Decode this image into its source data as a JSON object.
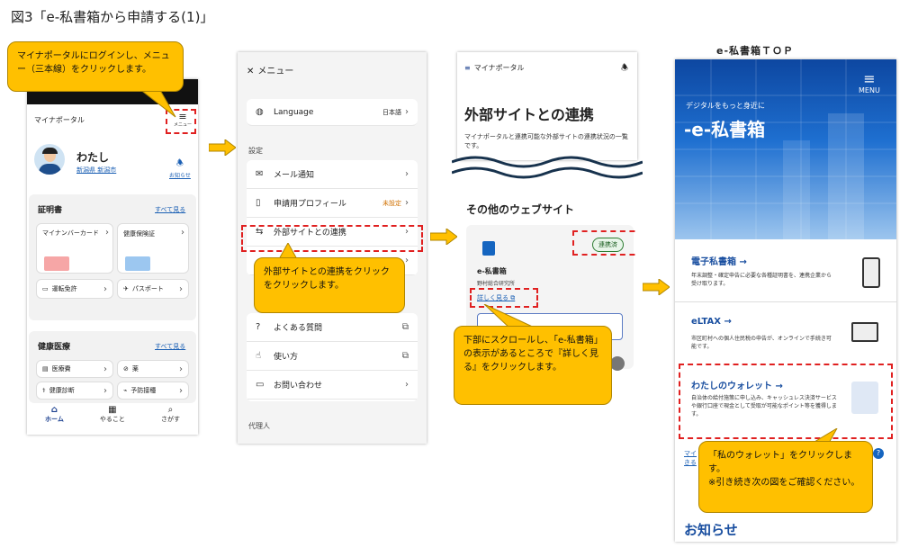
{
  "figure_title": "図3「e-私書箱から申請する(1)」",
  "screen1": {
    "app_name": "マイナポータル",
    "menu_label": "メニュー",
    "user_name": "わたし",
    "user_location": "新潟県 新潟市",
    "notice_label": "お知らせ",
    "cert_title": "証明書",
    "see_all": "すべて見る",
    "cert_items": [
      "マイナンバーカード",
      "健康保険証",
      "運転免許",
      "パスポート"
    ],
    "health_title": "健康医療",
    "health_see_all": "すべて見る",
    "health_items": [
      "医療費",
      "薬",
      "健康診断",
      "予防接種"
    ],
    "nav": [
      "ホーム",
      "やること",
      "さがす"
    ],
    "callout": "マイナポータルにログインし、メニュー（三本線）をクリックします。"
  },
  "screen2": {
    "header": "メニュー",
    "language_label": "Language",
    "language_value": "日本語",
    "section_settings": "設定",
    "rows": [
      {
        "label": "メール通知",
        "value": ""
      },
      {
        "label": "申請用プロフィール",
        "value": "未設定"
      },
      {
        "label": "外部サイトとの連携",
        "value": ""
      }
    ],
    "help_rows": [
      "よくある質問",
      "使い方",
      "お問い合わせ"
    ],
    "section_agent": "代理人",
    "callout": "外部サイトとの連携をクリックをクリックします。"
  },
  "screen3": {
    "app_name": "マイナポータル",
    "page_title": "外部サイトとの連携",
    "description": "マイナポータルと連携可能な外部サイトの連携状況の一覧です。",
    "other_sites_title": "その他のウェブサイト",
    "status_badge": "連携済",
    "site_name": "e-私書箱",
    "site_org": "野村総合研究所",
    "details_link": "詳しく見る",
    "callout": "下部にスクロールし、「e-私書箱」の表示があるところで『詳しく見る』をクリックします。"
  },
  "screen4": {
    "caption": "e-私書箱ＴＯＰ",
    "menu_label": "MENU",
    "tagline": "デジタルをもっと身近に",
    "logo": "-e-私書箱",
    "services": [
      {
        "title": "電子私書箱 →",
        "desc": "年末調整・確定申告に必要な各種証明書を、連携企業から受け取ります。"
      },
      {
        "title": "eLTAX →",
        "desc": "市区町村への個人住民税の申告が、オンラインで手続き可能です。"
      },
      {
        "title": "わたしのウォレット →",
        "desc": "自治体の給付施策に申し込み、キャッシュレス決済サービスや銀行口座で現金として受取が可能なポイント等を獲得します。"
      }
    ],
    "news_title": "お知らせ",
    "side_link": "マイ きる",
    "callout_line1": "「私のウォレット」をクリックします。",
    "callout_line2": "※引き続き次の図をご確認ください。"
  },
  "colors": {
    "callout": "#FFC000",
    "redbox": "#e02020",
    "link": "#1a5fb4",
    "hero_blue": "#1565c0"
  }
}
